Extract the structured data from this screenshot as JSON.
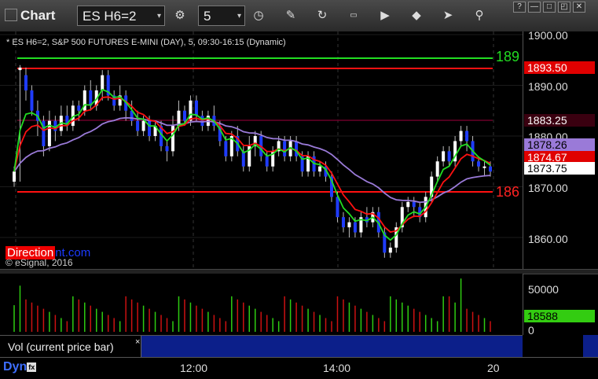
{
  "window": {
    "title": "Chart",
    "controls": [
      "?",
      "—",
      "□",
      "✕"
    ]
  },
  "toolbar": {
    "symbol": "ES H6=2",
    "interval": "5",
    "icons": [
      "settings-icon",
      "clock-icon",
      "pencil-icon",
      "refresh-icon",
      "quote-icon",
      "play-icon",
      "eraser-icon",
      "pin-icon"
    ]
  },
  "chart": {
    "header": "* ES H6=2, S&P 500 FUTURES E-MINI (DAY), 5, 09:30-16:15 (Dynamic)",
    "watermark": {
      "part1": "Direction",
      "part2": "nt.com"
    },
    "copyright": "© eSignal, 2016",
    "level_labels": {
      "top": "189",
      "bottom": "186"
    },
    "y_ticks": [
      "1900.00",
      "1890.00",
      "1880.00",
      "1870.00",
      "1860.00"
    ],
    "price_boxes": [
      {
        "text": "1893.50",
        "bg": "#e00000",
        "fg": "#ffffff"
      },
      {
        "text": "1883.25",
        "bg": "#3a0010",
        "fg": "#ffffff"
      },
      {
        "text": "1878.26",
        "bg": "#9a7ad8",
        "fg": "#000000"
      },
      {
        "text": "1874.67",
        "bg": "#e00000",
        "fg": "#ffffff"
      },
      {
        "text": "1873.75",
        "bg": "#ffffff",
        "fg": "#000000"
      }
    ],
    "colors": {
      "up_candle": "#ffffff",
      "down_candle": "#1f3cff",
      "green_line": "#22dd22",
      "red_line": "#ff1111",
      "purple_line": "#9a7ad8",
      "maroon_line": "#6a0028"
    }
  },
  "volume": {
    "y_ticks": [
      "50000",
      "0"
    ],
    "current_value": "18588",
    "study_label": "Vol (current price bar)",
    "close_label": "×"
  },
  "bottom": {
    "dyn_label": "Dyn",
    "fx_label": "fx",
    "x_ticks": [
      "12:00",
      "14:00",
      "20"
    ]
  }
}
